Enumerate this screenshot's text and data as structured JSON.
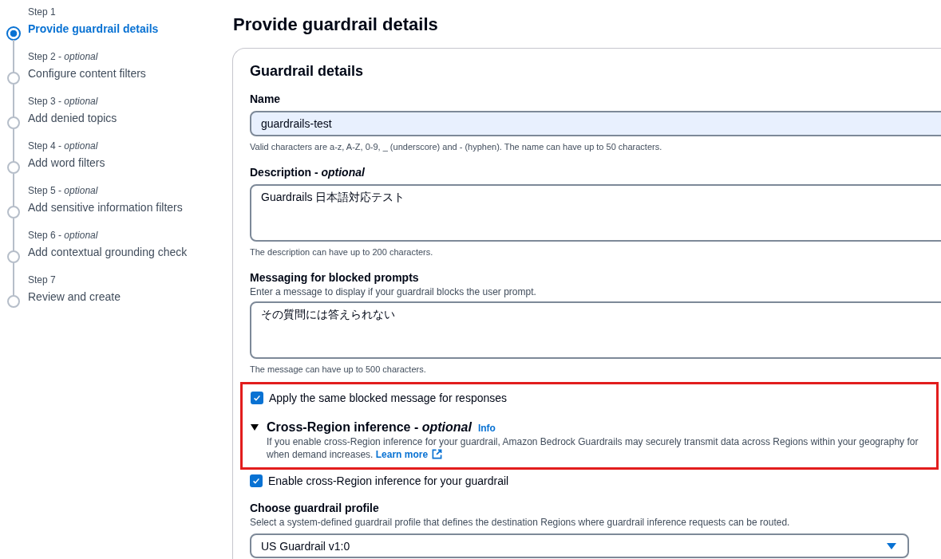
{
  "steps": [
    {
      "label": "Step 1",
      "title": "Provide guardrail details",
      "selected": true
    },
    {
      "label": "Step 2 - *optional*",
      "title": "Configure content filters",
      "selected": false
    },
    {
      "label": "Step 3 - *optional*",
      "title": "Add denied topics",
      "selected": false
    },
    {
      "label": "Step 4 - *optional*",
      "title": "Add word filters",
      "selected": false
    },
    {
      "label": "Step 5 - *optional*",
      "title": "Add sensitive information filters",
      "selected": false
    },
    {
      "label": "Step 6 - *optional*",
      "title": "Add contextual grounding check",
      "selected": false
    },
    {
      "label": "Step 7",
      "title": "Review and create",
      "selected": false
    }
  ],
  "page_title": "Provide guardrail details",
  "card": {
    "title": "Guardrail details",
    "name": {
      "label": "Name",
      "value": "guardrails-test",
      "hint": "Valid characters are a-z, A-Z, 0-9, _ (underscore) and - (hyphen). The name can have up to 50 characters."
    },
    "description": {
      "label": "Description - *optional*",
      "value": "Guardrails 日本語対応テスト",
      "hint": "The description can have up to 200 characters."
    },
    "messaging": {
      "label": "Messaging for blocked prompts",
      "description": "Enter a message to display if your guardrail blocks the user prompt.",
      "value": "その質問には答えられない",
      "hint": "The message can have up to 500 characters."
    },
    "highlight": {
      "on": true,
      "apply_same": {
        "label": "Apply the same blocked message for responses",
        "checked": true
      },
      "cross_region": {
        "title": "Cross-Region inference - *optional*",
        "expanded": true,
        "info": "Info",
        "text_line_1": "If you enable cross-Region inference for your guardrail, Amazon Bedrock Guardrails may securely transmit data across Regions within your geography for",
        "text_line_2": "when demand increases.",
        "link": "Learn more"
      }
    },
    "enable_cross_region": {
      "label": "Enable cross-Region inference for your guardrail",
      "checked": true
    },
    "profile": {
      "label": "Choose guardrail profile",
      "description": "Select a system-defined guardrail profile that defines the destination Regions where guardrail inference requests can be routed.",
      "value": "US Guardrail v1:0"
    }
  }
}
